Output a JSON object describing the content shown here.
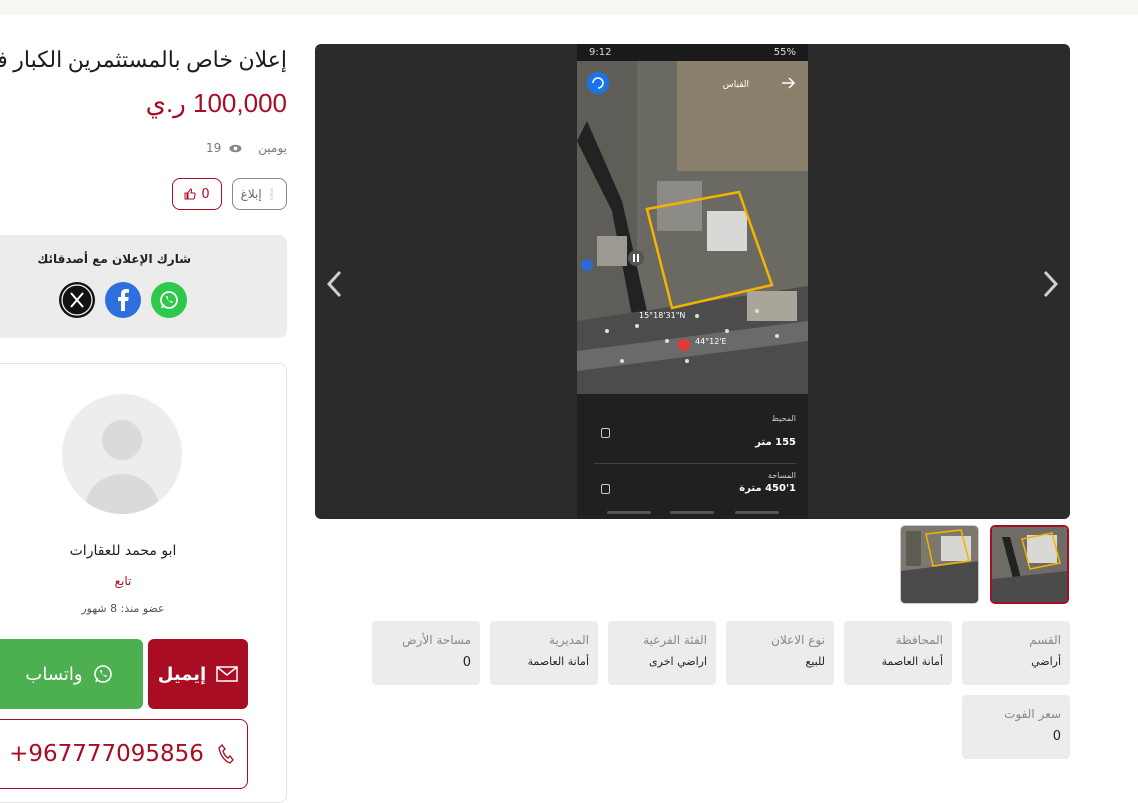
{
  "listing": {
    "title": "إعلان خاص بالمستثمرين الكبار فقط",
    "price": "100,000 ر.ي",
    "posted_ago": "يومين",
    "views": "19",
    "likes": "0",
    "report_label": "إبلاغ"
  },
  "share": {
    "title": "شارك الإعلان مع أصدقائك",
    "icons": [
      "x-icon",
      "facebook-icon",
      "whatsapp-icon"
    ]
  },
  "seller": {
    "name": "ابو محمد للعقارات",
    "follow_label": "تابع",
    "member_since": "عضو منذ: 8 شهور",
    "whatsapp_label": "واتساب",
    "email_label": "إيميل",
    "phone": "+967777095856"
  },
  "gallery": {
    "phone_status": {
      "time": "9:12",
      "battery": "55%"
    },
    "measure_header": "القياس",
    "coords": [
      "15°18'31\"N",
      "44°12'E"
    ],
    "perimeter_label": "المحيط",
    "perimeter_value": "155 متر",
    "area_label": "المساحة",
    "area_value": "1'450 مترة",
    "thumbnails": 2,
    "active_thumbnail": 1
  },
  "specs": [
    {
      "label": "القسم",
      "value": "أراضي"
    },
    {
      "label": "المحافظة",
      "value": "أمانة العاصمة"
    },
    {
      "label": "نوع الاعلان",
      "value": "للبيع"
    },
    {
      "label": "الفئة الفرعية",
      "value": "اراضي اخرى"
    },
    {
      "label": "المديرية",
      "value": "أمانة العاصمة"
    },
    {
      "label": "مساحة الأرض",
      "value": "0"
    },
    {
      "label": "سعر الفوت",
      "value": "0"
    }
  ],
  "colors": {
    "brand": "#a80d24",
    "whatsapp": "#4caf50",
    "facebook": "#2e6fe0"
  }
}
